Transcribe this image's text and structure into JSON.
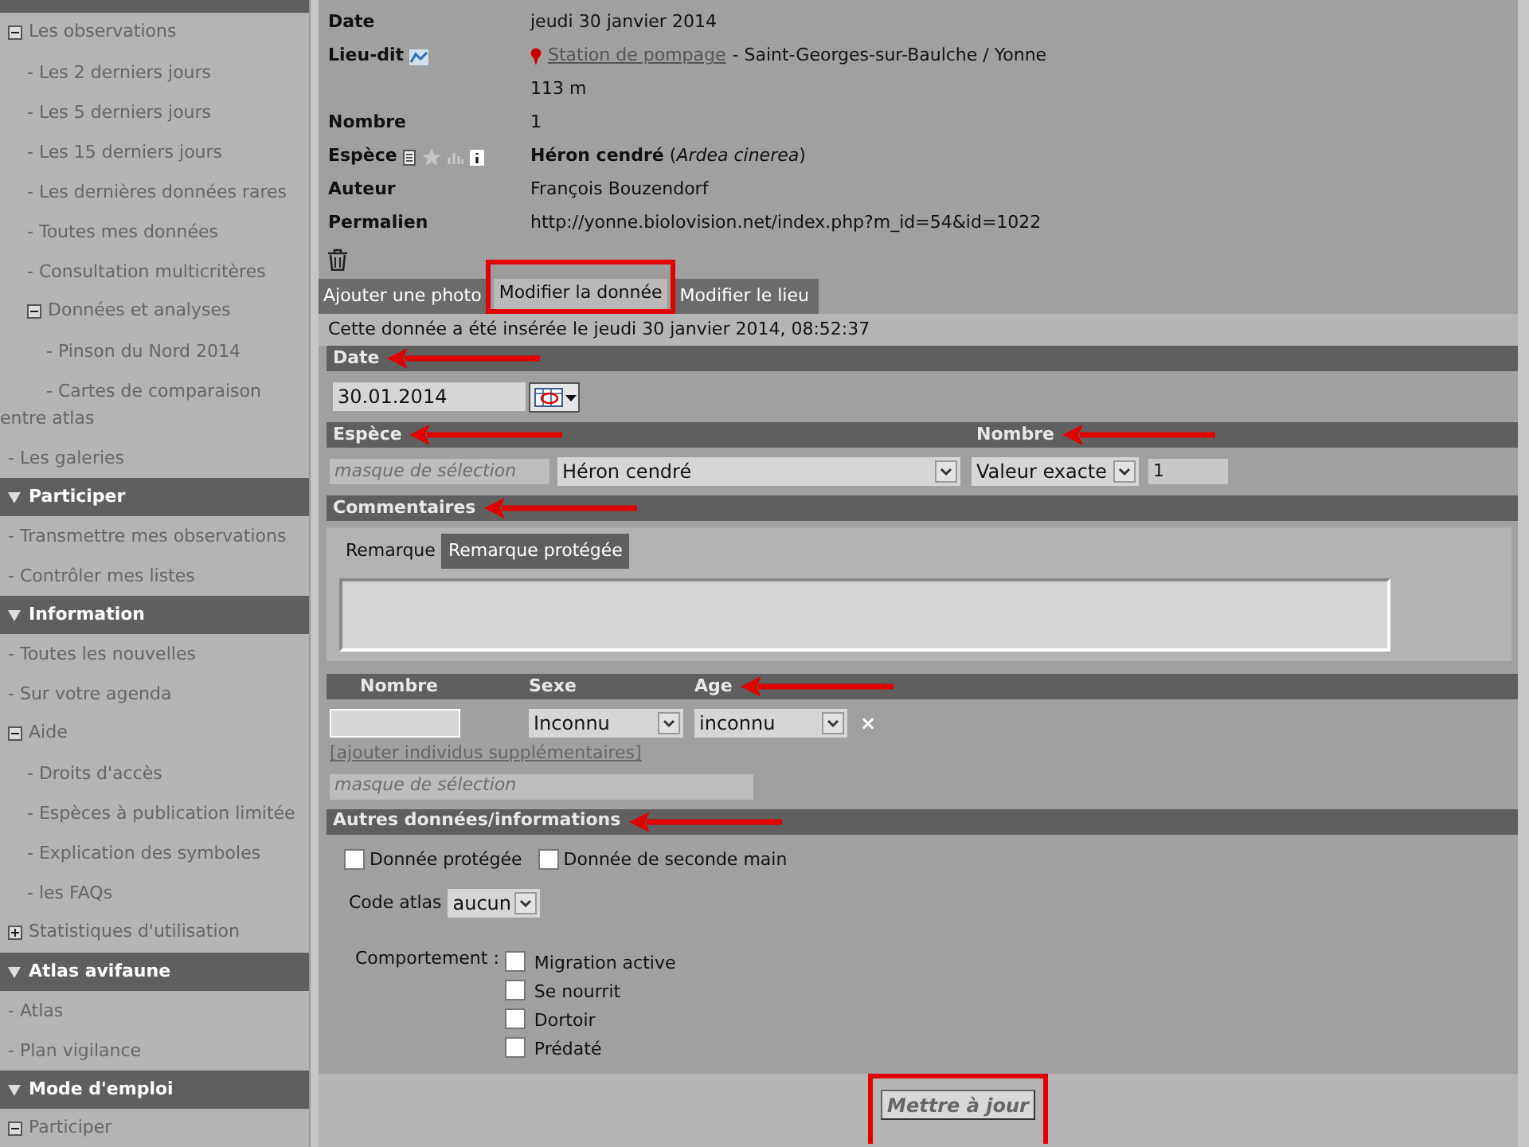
{
  "sidebar": {
    "sections": [
      {
        "items": [
          {
            "kind": "expander",
            "label": "Les observations",
            "expanded": true,
            "children": [
              {
                "kind": "link",
                "label": "- Les 2 derniers jours"
              },
              {
                "kind": "link",
                "label": "- Les 5 derniers jours"
              },
              {
                "kind": "link",
                "label": "- Les 15 derniers jours"
              },
              {
                "kind": "link",
                "label": "- Les dernières données rares"
              },
              {
                "kind": "link",
                "label": "- Toutes mes données"
              },
              {
                "kind": "link",
                "label": "- Consultation multicritères"
              },
              {
                "kind": "expander",
                "label": "Données et analyses",
                "expanded": true,
                "children": [
                  {
                    "kind": "link",
                    "label": "- Pinson du Nord 2014"
                  },
                  {
                    "kind": "link",
                    "label": "- Cartes de comparaison entre atlas"
                  }
                ]
              }
            ]
          },
          {
            "kind": "link",
            "label": "- Les galeries"
          }
        ]
      },
      {
        "title": "Participer",
        "items": [
          {
            "kind": "link",
            "label": "- Transmettre mes observations"
          },
          {
            "kind": "link",
            "label": "- Contrôler mes listes"
          }
        ]
      },
      {
        "title": "Information",
        "items": [
          {
            "kind": "link",
            "label": "- Toutes les nouvelles"
          },
          {
            "kind": "link",
            "label": "- Sur votre agenda"
          },
          {
            "kind": "expander",
            "label": "Aide",
            "expanded": true,
            "children": [
              {
                "kind": "link",
                "label": "- Droits d'accès"
              },
              {
                "kind": "link",
                "label": "- Espèces à publication limitée"
              },
              {
                "kind": "link",
                "label": "- Explication des symboles"
              },
              {
                "kind": "link",
                "label": "- les FAQs"
              }
            ]
          },
          {
            "kind": "expander",
            "label": "Statistiques d'utilisation",
            "expanded": false
          }
        ]
      },
      {
        "title": "Atlas avifaune",
        "items": [
          {
            "kind": "link",
            "label": "- Atlas"
          },
          {
            "kind": "link",
            "label": "- Plan vigilance"
          }
        ]
      },
      {
        "title": "Mode d'emploi",
        "items": [
          {
            "kind": "expander",
            "label": "Participer",
            "expanded": true
          }
        ]
      }
    ]
  },
  "details": [
    {
      "kind": "text",
      "label": "Date",
      "value": "jeudi 30 janvier 2014"
    },
    {
      "kind": "place",
      "label": "Lieu-dit",
      "link": "Station de pompage",
      "value": "- Saint-Georges-sur-Baulche / Yonne"
    },
    {
      "kind": "text",
      "value": "113 m"
    },
    {
      "kind": "text",
      "label": "Nombre",
      "value": "1"
    },
    {
      "kind": "species",
      "label": "Espèce",
      "value": "**Héron cendré** (*Ardea cinerea*)"
    },
    {
      "kind": "text",
      "label": "Auteur",
      "value": "François Bouzendorf"
    },
    {
      "kind": "text",
      "label": "Permalien",
      "value": "http://yonne.biolovision.net/index.php?m_id=54&id=1022"
    }
  ],
  "tabs": [
    {
      "label": "Ajouter une photo",
      "selected": false,
      "framed": false
    },
    {
      "label": "Modifier la donnée",
      "selected": true,
      "framed": true
    },
    {
      "label": "Modifier le lieu",
      "selected": false,
      "framed": false
    }
  ],
  "inserted_note": "Cette donnée a été insérée le jeudi 30 janvier 2014, 08:52:37",
  "date_section": {
    "title": "Date",
    "arrow": true,
    "value": "30.01.2014"
  },
  "species_section": {
    "headers": [
      {
        "title": "Espèce",
        "arrow": true
      },
      {
        "title": "Nombre",
        "arrow": true
      }
    ],
    "filter_placeholder": "masque de sélection",
    "species": "Héron cendré",
    "count_type": "Valeur exacte",
    "count": "1"
  },
  "comments_section": {
    "title": "Commentaires",
    "arrow": true,
    "tabs": [
      {
        "label": "Remarque",
        "selected": true
      },
      {
        "label": "Remarque protégée",
        "selected": false
      }
    ]
  },
  "individuals_section": {
    "columns": [
      {
        "title": "Nombre",
        "arrow": false
      },
      {
        "title": "Sexe",
        "arrow": false
      },
      {
        "title": "Age",
        "arrow": true
      }
    ],
    "sex": "Inconnu",
    "age": "inconnu",
    "remove": "×",
    "add_link": "[ajouter individus supplémentaires]",
    "filter_placeholder": "masque de sélection"
  },
  "other_section": {
    "title": "Autres données/informations",
    "arrow": true,
    "flags": [
      {
        "label": "Donnée protégée",
        "checked": false
      },
      {
        "label": "Donnée de seconde main",
        "checked": false
      }
    ],
    "atlas_label": "Code atlas",
    "atlas_value": "aucun",
    "behaviour_label": "Comportement :",
    "behaviours": [
      {
        "label": "Migration active",
        "checked": false
      },
      {
        "label": "Se nourrit",
        "checked": false
      },
      {
        "label": "Dortoir",
        "checked": false
      },
      {
        "label": "Prédaté",
        "checked": false
      }
    ]
  },
  "submit": {
    "label": "Mettre à jour",
    "framed": true
  }
}
